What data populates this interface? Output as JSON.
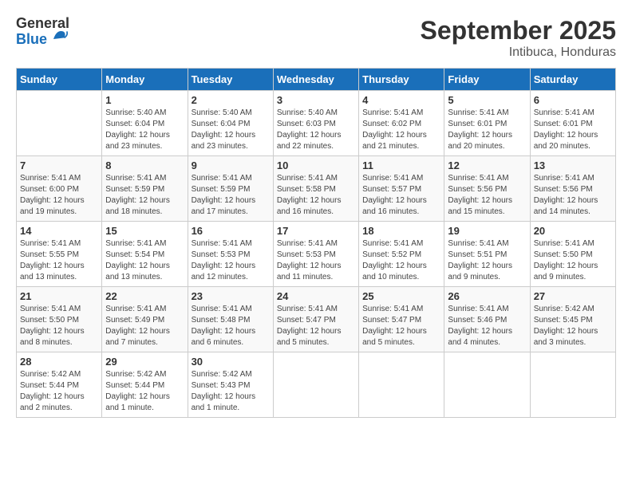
{
  "header": {
    "logo_general": "General",
    "logo_blue": "Blue",
    "month_title": "September 2025",
    "subtitle": "Intibuca, Honduras"
  },
  "days_of_week": [
    "Sunday",
    "Monday",
    "Tuesday",
    "Wednesday",
    "Thursday",
    "Friday",
    "Saturday"
  ],
  "weeks": [
    [
      {
        "day": "",
        "info": ""
      },
      {
        "day": "1",
        "info": "Sunrise: 5:40 AM\nSunset: 6:04 PM\nDaylight: 12 hours\nand 23 minutes."
      },
      {
        "day": "2",
        "info": "Sunrise: 5:40 AM\nSunset: 6:04 PM\nDaylight: 12 hours\nand 23 minutes."
      },
      {
        "day": "3",
        "info": "Sunrise: 5:40 AM\nSunset: 6:03 PM\nDaylight: 12 hours\nand 22 minutes."
      },
      {
        "day": "4",
        "info": "Sunrise: 5:41 AM\nSunset: 6:02 PM\nDaylight: 12 hours\nand 21 minutes."
      },
      {
        "day": "5",
        "info": "Sunrise: 5:41 AM\nSunset: 6:01 PM\nDaylight: 12 hours\nand 20 minutes."
      },
      {
        "day": "6",
        "info": "Sunrise: 5:41 AM\nSunset: 6:01 PM\nDaylight: 12 hours\nand 20 minutes."
      }
    ],
    [
      {
        "day": "7",
        "info": "Sunrise: 5:41 AM\nSunset: 6:00 PM\nDaylight: 12 hours\nand 19 minutes."
      },
      {
        "day": "8",
        "info": "Sunrise: 5:41 AM\nSunset: 5:59 PM\nDaylight: 12 hours\nand 18 minutes."
      },
      {
        "day": "9",
        "info": "Sunrise: 5:41 AM\nSunset: 5:59 PM\nDaylight: 12 hours\nand 17 minutes."
      },
      {
        "day": "10",
        "info": "Sunrise: 5:41 AM\nSunset: 5:58 PM\nDaylight: 12 hours\nand 16 minutes."
      },
      {
        "day": "11",
        "info": "Sunrise: 5:41 AM\nSunset: 5:57 PM\nDaylight: 12 hours\nand 16 minutes."
      },
      {
        "day": "12",
        "info": "Sunrise: 5:41 AM\nSunset: 5:56 PM\nDaylight: 12 hours\nand 15 minutes."
      },
      {
        "day": "13",
        "info": "Sunrise: 5:41 AM\nSunset: 5:56 PM\nDaylight: 12 hours\nand 14 minutes."
      }
    ],
    [
      {
        "day": "14",
        "info": "Sunrise: 5:41 AM\nSunset: 5:55 PM\nDaylight: 12 hours\nand 13 minutes."
      },
      {
        "day": "15",
        "info": "Sunrise: 5:41 AM\nSunset: 5:54 PM\nDaylight: 12 hours\nand 13 minutes."
      },
      {
        "day": "16",
        "info": "Sunrise: 5:41 AM\nSunset: 5:53 PM\nDaylight: 12 hours\nand 12 minutes."
      },
      {
        "day": "17",
        "info": "Sunrise: 5:41 AM\nSunset: 5:53 PM\nDaylight: 12 hours\nand 11 minutes."
      },
      {
        "day": "18",
        "info": "Sunrise: 5:41 AM\nSunset: 5:52 PM\nDaylight: 12 hours\nand 10 minutes."
      },
      {
        "day": "19",
        "info": "Sunrise: 5:41 AM\nSunset: 5:51 PM\nDaylight: 12 hours\nand 9 minutes."
      },
      {
        "day": "20",
        "info": "Sunrise: 5:41 AM\nSunset: 5:50 PM\nDaylight: 12 hours\nand 9 minutes."
      }
    ],
    [
      {
        "day": "21",
        "info": "Sunrise: 5:41 AM\nSunset: 5:50 PM\nDaylight: 12 hours\nand 8 minutes."
      },
      {
        "day": "22",
        "info": "Sunrise: 5:41 AM\nSunset: 5:49 PM\nDaylight: 12 hours\nand 7 minutes."
      },
      {
        "day": "23",
        "info": "Sunrise: 5:41 AM\nSunset: 5:48 PM\nDaylight: 12 hours\nand 6 minutes."
      },
      {
        "day": "24",
        "info": "Sunrise: 5:41 AM\nSunset: 5:47 PM\nDaylight: 12 hours\nand 5 minutes."
      },
      {
        "day": "25",
        "info": "Sunrise: 5:41 AM\nSunset: 5:47 PM\nDaylight: 12 hours\nand 5 minutes."
      },
      {
        "day": "26",
        "info": "Sunrise: 5:41 AM\nSunset: 5:46 PM\nDaylight: 12 hours\nand 4 minutes."
      },
      {
        "day": "27",
        "info": "Sunrise: 5:42 AM\nSunset: 5:45 PM\nDaylight: 12 hours\nand 3 minutes."
      }
    ],
    [
      {
        "day": "28",
        "info": "Sunrise: 5:42 AM\nSunset: 5:44 PM\nDaylight: 12 hours\nand 2 minutes."
      },
      {
        "day": "29",
        "info": "Sunrise: 5:42 AM\nSunset: 5:44 PM\nDaylight: 12 hours\nand 1 minute."
      },
      {
        "day": "30",
        "info": "Sunrise: 5:42 AM\nSunset: 5:43 PM\nDaylight: 12 hours\nand 1 minute."
      },
      {
        "day": "",
        "info": ""
      },
      {
        "day": "",
        "info": ""
      },
      {
        "day": "",
        "info": ""
      },
      {
        "day": "",
        "info": ""
      }
    ]
  ]
}
